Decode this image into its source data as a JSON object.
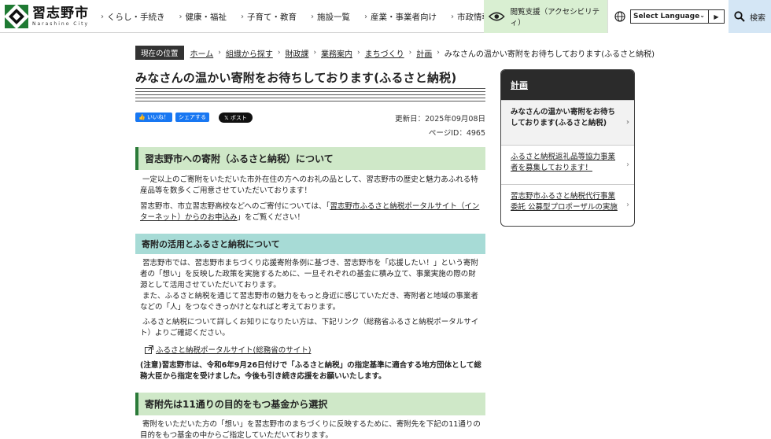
{
  "header": {
    "logo_text": "習志野市",
    "logo_sub": "Narashino City",
    "nav": [
      "くらし・手続き",
      "健康・福祉",
      "子育て・教育",
      "施設一覧",
      "産業・事業者向け",
      "市政情報"
    ],
    "accessibility": "閲覧支援（アクセシビリティ）",
    "language_select": "Select Language",
    "search": "検索"
  },
  "breadcrumb": {
    "label": "現在の位置",
    "items": [
      "ホーム",
      "組織から探す",
      "財政課",
      "業務案内",
      "まちづくり",
      "計画"
    ],
    "current": "みなさんの温かい寄附をお待ちしております(ふるさと納税)"
  },
  "page": {
    "title": "みなさんの温かい寄附をお待ちしております(ふるさと納税)",
    "social": {
      "like": "いいね！",
      "share": "シェアする",
      "post": "ポスト"
    },
    "updated": "更新日：2025年09月08日",
    "page_id": "ページID：4965"
  },
  "sections": {
    "h2_1": "習志野市への寄附（ふるさと納税）について",
    "p1": "一定以上のご寄附をいただいた市外在住の方へのお礼の品として、習志野市の歴史と魅力あふれる特産品等を数多くご用意させていただいております！",
    "p2_pre": "習志野市、市立習志野高校などへのご寄付については、「",
    "p2_link": "習志野市ふるさと納税ポータルサイト（インターネット）からのお申込み",
    "p2_post": "」をご覧ください！",
    "h3_1": "寄附の活用とふるさと納税について",
    "p3": "習志野市では、習志野市まちづくり応援寄附条例に基づき、習志野市を「応援したい！」という寄附者の「想い」を反映した政策を実施するために、一旦それぞれの基金に積み立て、事業実施の際の財源として活用させていただいております。",
    "p4": "また、ふるさと納税を通じて習志野市の魅力をもっと身近に感じていただき、寄附者と地域の事業者などの「人」をつなぐきっかけとなればと考えております。",
    "p5": "ふるさと納税について詳しくお知りになりたい方は、下記リンク（総務省ふるさと納税ポータルサイト）よりご確認ください。",
    "ext_link": "ふるさと納税ポータルサイト(総務省のサイト)",
    "note": "(注意)習志野市は、令和6年9月26日付けで「ふるさと納税」の指定基準に適合する地方団体として総務大臣から指定を受けました。今後も引き続き応援をお願いいたします。",
    "h2_2": "寄附先は11通りの目的をもつ基金から選択",
    "p6": "寄附をいただいた方の「想い」を習志野市のまちづくりに反映するために、寄附先を下記の11通りの目的をもつ基金の中からご指定していただいております。"
  },
  "side": {
    "heading": "計画",
    "items": [
      "みなさんの温かい寄附をお待ちしております(ふるさと納税)",
      "ふるさと納税返礼品等協力事業者を募集しております！",
      "習志野市ふるさと納税代行事業委託 公募型プロポーザルの実施"
    ]
  },
  "colors": {
    "accent_green": "#2b7a39",
    "section_green": "#cfe8c8",
    "section_teal": "#a7dbd6",
    "a11y_bg": "#d9efd2",
    "search_bg": "#d4e6f5"
  }
}
